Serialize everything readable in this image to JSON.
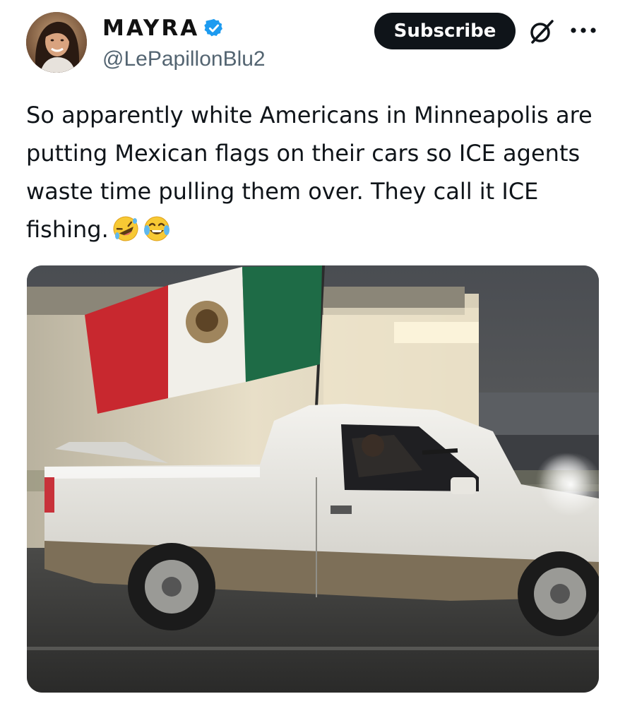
{
  "author": {
    "display_name": "MAYRA",
    "handle": "@LePapillonBlu2",
    "verified": true,
    "avatar": "profile-photo-woman"
  },
  "actions": {
    "subscribe_label": "Subscribe",
    "grok_icon": "slashed-circle-icon",
    "more_icon": "more-dots-icon"
  },
  "tweet": {
    "text": "So apparently white Americans in Minneapolis are putting Mexican flags on their cars so ICE agents waste time pulling them over. They call it ICE fishing.",
    "emojis": [
      "rolling-on-floor-laughing",
      "face-with-tears-of-joy"
    ]
  },
  "media": {
    "type": "photo",
    "subject": "white pickup truck with mexican flag"
  },
  "colors": {
    "subscribe_bg": "#0f1419",
    "verified_blue": "#1d9bf0",
    "handle_gray": "#536471"
  }
}
